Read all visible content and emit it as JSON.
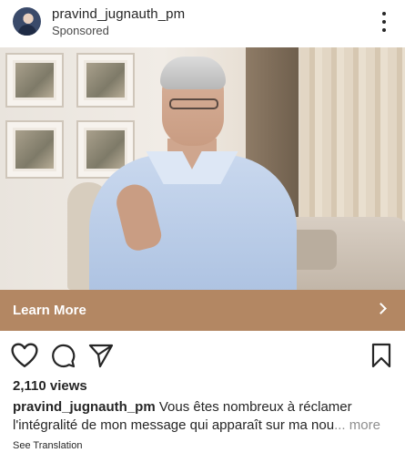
{
  "post": {
    "username": "pravind_jugnauth_pm",
    "label": "Sponsored",
    "menu_icon": "more-vertical-icon"
  },
  "media": {
    "description_kind": "video-frame"
  },
  "cta": {
    "label": "Learn More",
    "icon": "chevron-right-icon",
    "color": "#b38763"
  },
  "actions": {
    "icons": [
      "heart-icon",
      "comment-icon",
      "share-icon",
      "bookmark-icon"
    ]
  },
  "stats": {
    "views": "2,110 views"
  },
  "caption": {
    "username": "pravind_jugnauth_pm",
    "line1": "Vous êtes nombreux à réclamer",
    "line2": "l'intégralité de mon message qui apparaît sur ma nou",
    "ellipsis": "...",
    "more": "more"
  },
  "translation": {
    "label": "See Translation"
  }
}
